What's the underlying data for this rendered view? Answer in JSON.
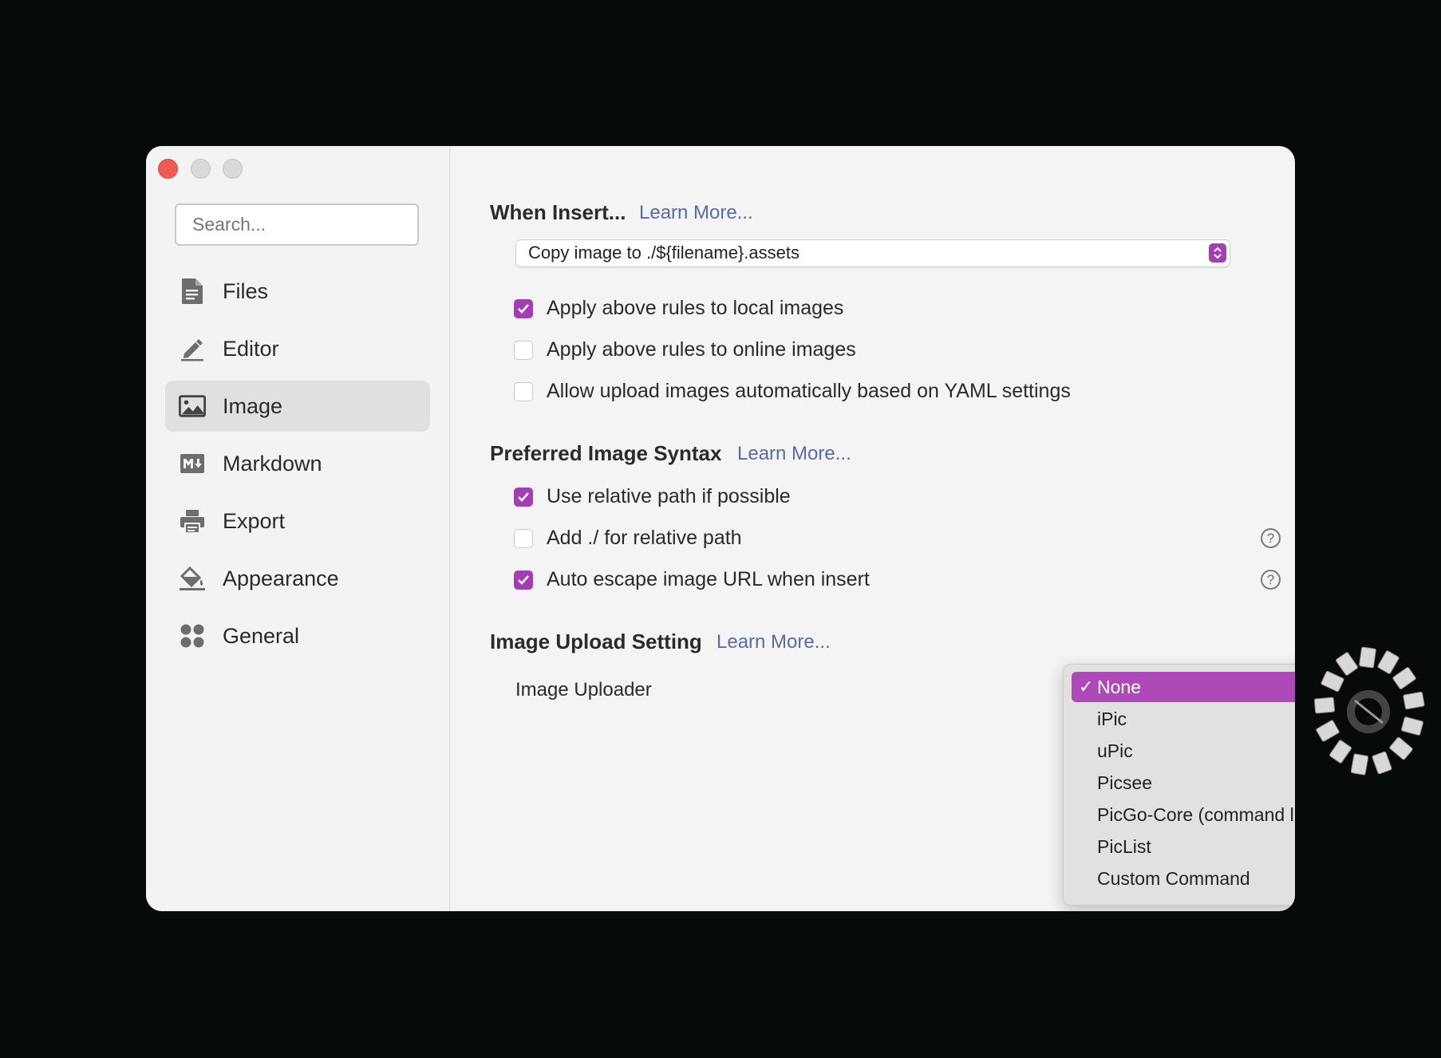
{
  "sidebar": {
    "search_placeholder": "Search...",
    "items": [
      {
        "label": "Files",
        "icon": "file-icon",
        "active": false
      },
      {
        "label": "Editor",
        "icon": "pencil-icon",
        "active": false
      },
      {
        "label": "Image",
        "icon": "image-icon",
        "active": true
      },
      {
        "label": "Markdown",
        "icon": "markdown-icon",
        "active": false
      },
      {
        "label": "Export",
        "icon": "printer-icon",
        "active": false
      },
      {
        "label": "Appearance",
        "icon": "paint-bucket-icon",
        "active": false
      },
      {
        "label": "General",
        "icon": "grid-dots-icon",
        "active": false
      }
    ]
  },
  "when_insert": {
    "title": "When Insert...",
    "learn_more": "Learn More...",
    "select_value": "Copy image to ./${filename}.assets",
    "options": [
      {
        "label": "Apply above rules to local images",
        "checked": true
      },
      {
        "label": "Apply above rules to online images",
        "checked": false
      },
      {
        "label": "Allow upload images automatically based on YAML settings",
        "checked": false
      }
    ]
  },
  "syntax": {
    "title": "Preferred Image Syntax",
    "learn_more": "Learn More...",
    "options": [
      {
        "label": "Use relative path if possible",
        "checked": true
      },
      {
        "label": "Add ./ for relative path",
        "checked": false
      },
      {
        "label": "Auto escape image URL when insert",
        "checked": true
      }
    ]
  },
  "upload": {
    "title": "Image Upload Setting",
    "learn_more": "Learn More...",
    "uploader_label": "Image Uploader",
    "menu": {
      "selected": "None",
      "check_mark": "✓",
      "items": [
        "None",
        "iPic",
        "uPic",
        "Picsee",
        "PicGo-Core (command line)",
        "PicList",
        "Custom Command"
      ]
    }
  },
  "colors": {
    "accent": "#a53bb5",
    "link": "#5a6aa6",
    "close": "#f05a52"
  }
}
